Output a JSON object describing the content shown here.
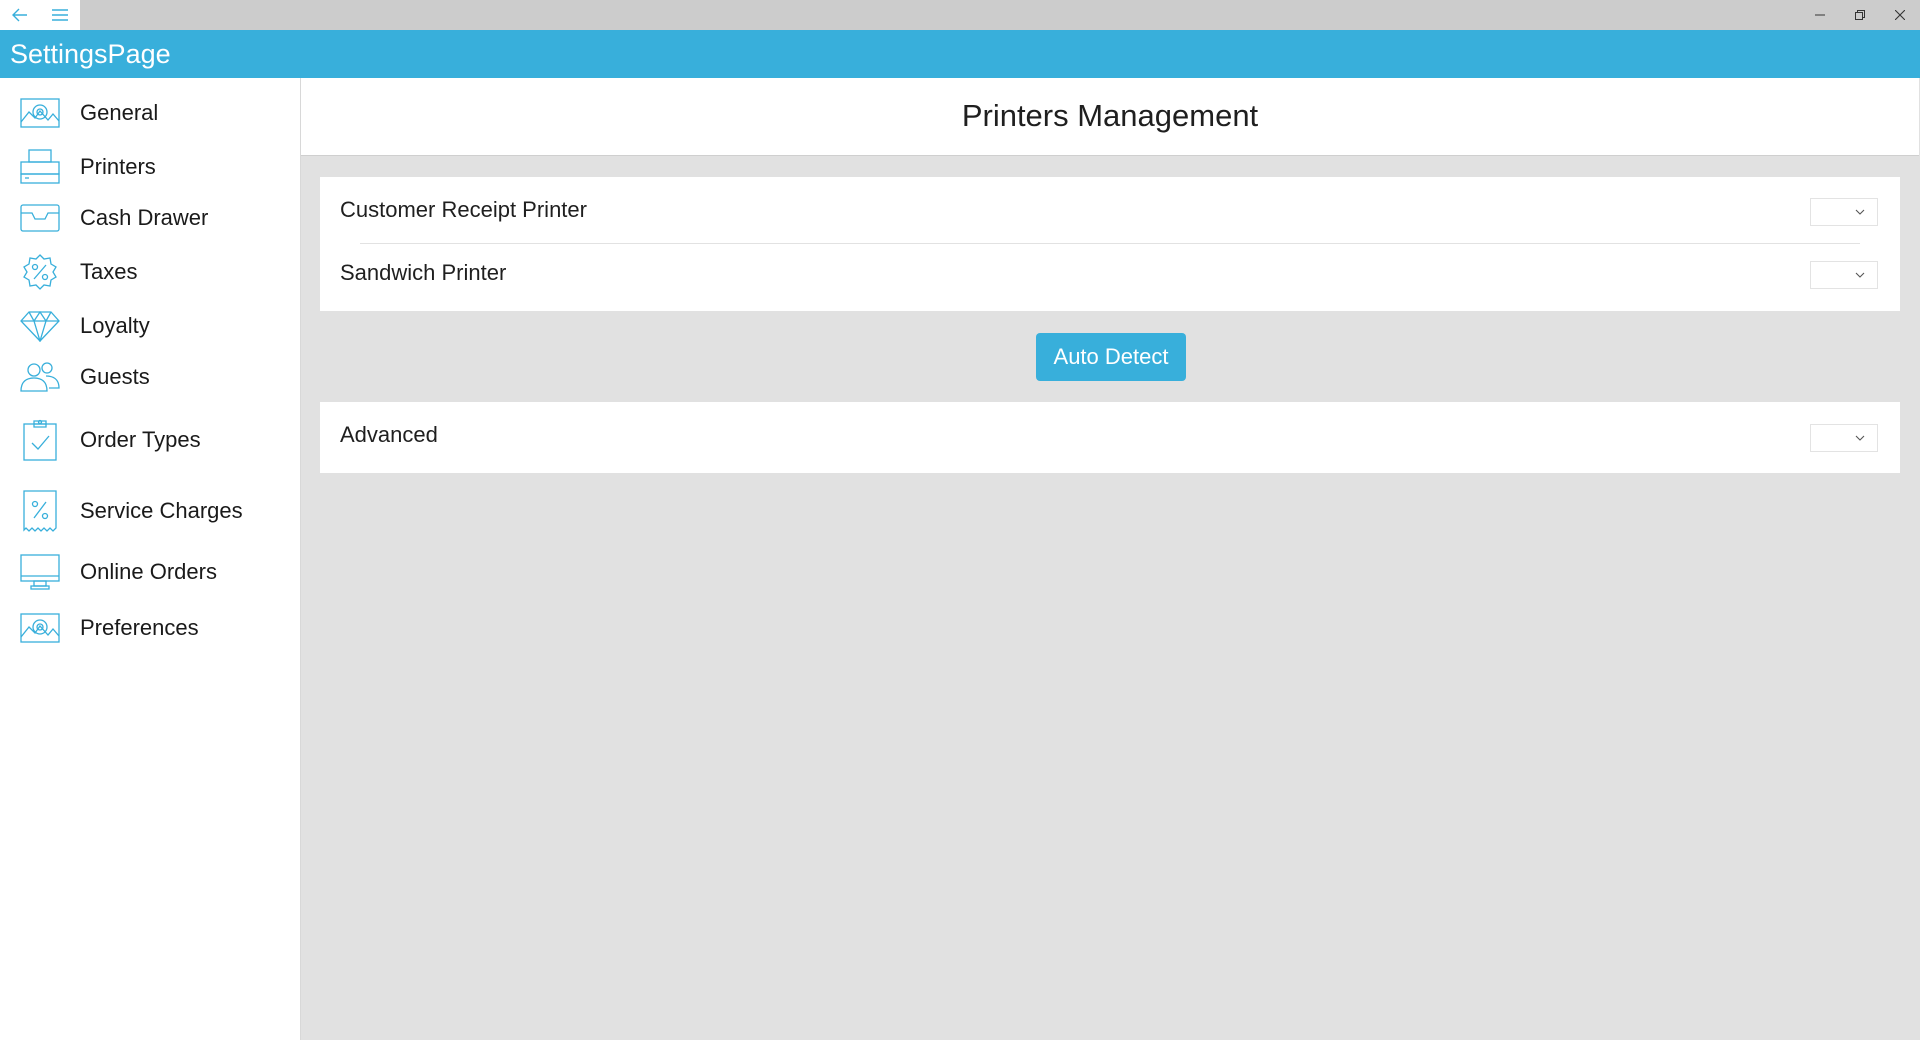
{
  "app": {
    "title": "SettingsPage",
    "accent_color": "#38afdb"
  },
  "titlebar": {
    "back_icon": "arrow-left-icon",
    "menu_icon": "hamburger-icon",
    "controls": [
      "minimize-icon",
      "restore-icon",
      "close-icon"
    ]
  },
  "sidebar": {
    "items": [
      {
        "label": "General",
        "icon": "gear-gallery-icon"
      },
      {
        "label": "Printers",
        "icon": "printer-icon"
      },
      {
        "label": "Cash Drawer",
        "icon": "cash-drawer-icon"
      },
      {
        "label": "Taxes",
        "icon": "percent-badge-icon"
      },
      {
        "label": "Loyalty",
        "icon": "diamond-icon"
      },
      {
        "label": "Guests",
        "icon": "guests-icon"
      },
      {
        "label": "Order Types",
        "icon": "clipboard-check-icon"
      },
      {
        "label": "Service Charges",
        "icon": "percent-receipt-icon"
      },
      {
        "label": "Online Orders",
        "icon": "monitor-icon"
      },
      {
        "label": "Preferences",
        "icon": "gear-gallery-icon"
      }
    ]
  },
  "main": {
    "title": "Printers Management",
    "printers": [
      {
        "label": "Customer Receipt Printer",
        "value": ""
      },
      {
        "label": "Sandwich Printer",
        "value": ""
      }
    ],
    "auto_detect_label": "Auto Detect",
    "advanced": {
      "label": "Advanced",
      "value": ""
    }
  }
}
